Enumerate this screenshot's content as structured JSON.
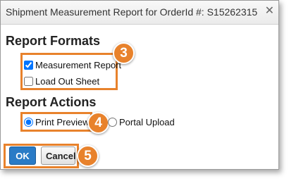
{
  "dialog": {
    "title": "Shipment Measurement Report for OrderId #: S15262315",
    "close_glyph": "✕"
  },
  "report_formats": {
    "heading": "Report Formats",
    "options": [
      {
        "label": "Measurement Report",
        "checked": true
      },
      {
        "label": "Load Out Sheet",
        "checked": false
      }
    ],
    "callout": "3"
  },
  "report_actions": {
    "heading": "Report Actions",
    "options": [
      {
        "label": "Print Preview",
        "selected": true
      },
      {
        "label": "Portal Upload",
        "selected": false
      }
    ],
    "callout": "4"
  },
  "buttons": {
    "ok_label": "OK",
    "cancel_label": "Cancel",
    "callout": "5"
  },
  "colors": {
    "callout_accent": "#e8822c",
    "ok_button": "#2a7bc6"
  },
  "icons": {
    "close": "close-icon"
  }
}
